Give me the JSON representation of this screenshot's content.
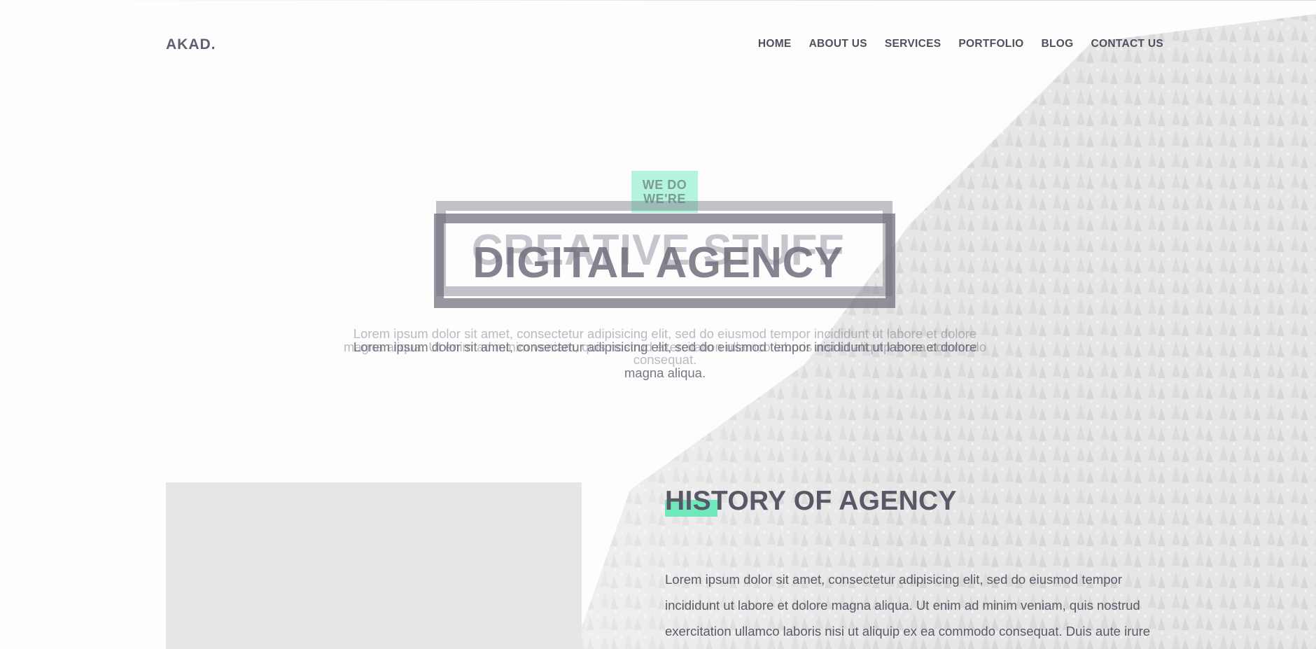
{
  "header": {
    "logo": "AKAD.",
    "nav": [
      "HOME",
      "ABOUT US",
      "SERVICES",
      "PORTFOLIO",
      "BLOG",
      "CONTACT US"
    ]
  },
  "hero": {
    "badge_ghost": "WE DO",
    "badge_main": "WE'RE",
    "title_ghost": "CREATIVE STUFF",
    "title_main": "DIGITAL AGENCY",
    "paragraph_ghost_lines": [
      "Lorem ipsum dolor sit amet, consectetur adipisicing elit, sed do eiusmod tempor incididunt ut labore et dolore",
      "magna aliqua. Ut enim ad minim veniam, quis nostrud exercitation ullamco laboris nisi ut aliquip ex ea commodo",
      "consequat."
    ],
    "paragraph_main_lines": [
      "Lorem ipsum dolor sit amet, consectetur adipisicing elit, sed do eiusmod tempor incididunt ut labore et dolore",
      "magna aliqua."
    ]
  },
  "history": {
    "title": "HISTORY OF AGENCY",
    "text_lines": [
      "Lorem ipsum dolor sit amet, consectetur adipisicing elit, sed do eiusmod tempor",
      "incididunt ut labore et dolore magna aliqua. Ut enim ad minim veniam, quis nostrud",
      "exercitation ullamco laboris nisi ut aliquip ex ea commodo consequat. Duis aute irure"
    ]
  },
  "colors": {
    "accent": "#5ae8b4",
    "text": "#585866"
  }
}
